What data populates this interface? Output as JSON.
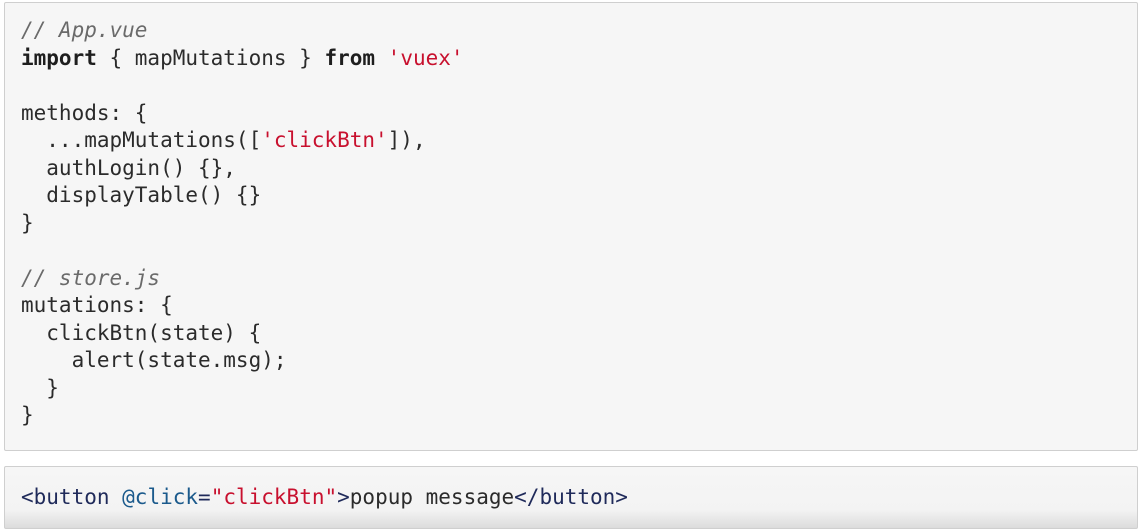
{
  "main_block": {
    "line1_comment": "// App.vue",
    "line2": {
      "kw1": "import",
      "mid": " { mapMutations } ",
      "kw2": "from",
      "sp": " ",
      "str": "'vuex'"
    },
    "line3": "",
    "line4": "methods: {",
    "line5": {
      "pre": "  ...mapMutations([",
      "str": "'clickBtn'",
      "post": "]),"
    },
    "line6": "  authLogin() {},",
    "line7": "  displayTable() {}",
    "line8": "}",
    "line9": "",
    "line10_comment": "// store.js",
    "line11": "mutations: {",
    "line12": "  clickBtn(state) {",
    "line13": "    alert(state.msg);",
    "line14": "  }",
    "line15": "}"
  },
  "button_block": {
    "tag_open": "<button",
    "attr_name": " @click",
    "eq": "=",
    "attr_value": "\"clickBtn\"",
    "tag_close_open": ">",
    "text": "popup message",
    "tag_end": "</button>"
  }
}
